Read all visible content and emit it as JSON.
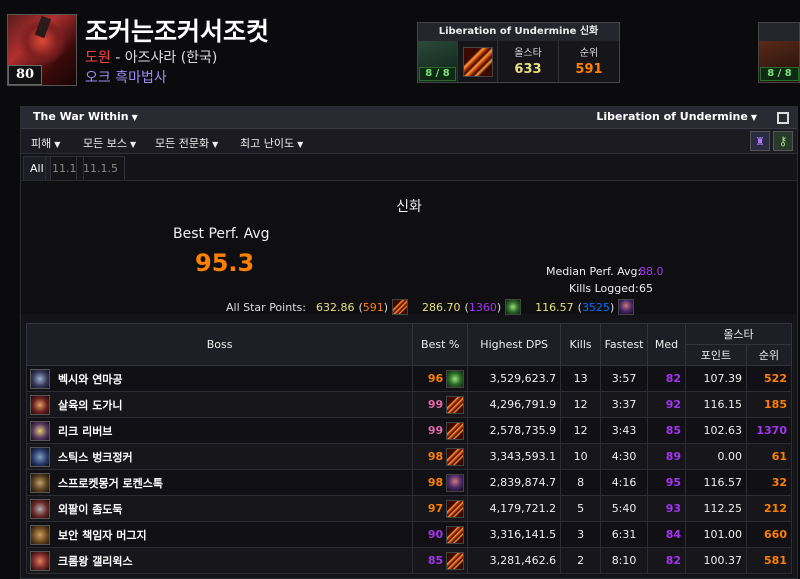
{
  "character": {
    "name": "조커는조커서조컷",
    "level": "80",
    "guild": "도원",
    "realm": " - 아즈샤라 (한국)",
    "class_spec": "오크 흑마법사"
  },
  "raid_summary": {
    "title": "Liberation of Undermine 신화",
    "kills": "8 / 8",
    "allstar_label": "올스타",
    "allstar_value": "633",
    "rank_label": "순위",
    "rank_value": "591",
    "second_kills": "8 / 8"
  },
  "tier_bar": {
    "expansion": "The War Within",
    "zone": "Liberation of Undermine"
  },
  "filters": [
    "피해",
    "모든 보스",
    "모든 전문화",
    "최고 난이도"
  ],
  "version_tabs": [
    "All",
    "11.1",
    "11.1.5"
  ],
  "summary": {
    "difficulty": "신화",
    "best_perf_label": "Best Perf. Avg",
    "best_perf_value": "95.3",
    "median_label": "Median Perf. Avg:",
    "median_value": "88.0",
    "kills_logged_label": "Kills Logged:",
    "kills_logged_value": "65",
    "all_star_label": "All Star Points:",
    "star1_points": "632.86",
    "star1_rank": "591",
    "star2_points": "286.70",
    "star2_rank": "1360",
    "star3_points": "116.57",
    "star3_rank": "3525"
  },
  "table": {
    "headers": {
      "boss": "Boss",
      "best": "Best %",
      "dps": "Highest DPS",
      "kills": "Kills",
      "fastest": "Fastest",
      "med": "Med",
      "allstar": "올스타",
      "points": "포인트",
      "rank": "순위"
    },
    "rows": [
      {
        "boss": "벡시와 연마공",
        "best": "96",
        "dps": "3,529,623.7",
        "kills": "13",
        "fastest": "3:57",
        "med": "82",
        "points": "107.39",
        "rank": "522"
      },
      {
        "boss": "살육의 도가니",
        "best": "99",
        "dps": "4,296,791.9",
        "kills": "12",
        "fastest": "3:37",
        "med": "92",
        "points": "116.15",
        "rank": "185"
      },
      {
        "boss": "리크 리버브",
        "best": "99",
        "dps": "2,578,735.9",
        "kills": "12",
        "fastest": "3:43",
        "med": "85",
        "points": "102.63",
        "rank": "1370"
      },
      {
        "boss": "스틱스 벙크정커",
        "best": "98",
        "dps": "3,343,593.1",
        "kills": "10",
        "fastest": "4:30",
        "med": "89",
        "points": "0.00",
        "rank": "61"
      },
      {
        "boss": "스프로켓몽거 로켄스톡",
        "best": "98",
        "dps": "2,839,874.7",
        "kills": "8",
        "fastest": "4:16",
        "med": "95",
        "points": "116.57",
        "rank": "32"
      },
      {
        "boss": "외팔이 좀도둑",
        "best": "97",
        "dps": "4,179,721.2",
        "kills": "5",
        "fastest": "5:40",
        "med": "93",
        "points": "112.25",
        "rank": "212"
      },
      {
        "boss": "보안 책임자 머그지",
        "best": "90",
        "dps": "3,316,141.5",
        "kills": "3",
        "fastest": "6:31",
        "med": "84",
        "points": "101.00",
        "rank": "660"
      },
      {
        "boss": "크롬왕 갤리윅스",
        "best": "85",
        "dps": "3,281,462.6",
        "kills": "2",
        "fastest": "8:10",
        "med": "82",
        "points": "100.37",
        "rank": "581"
      }
    ]
  },
  "colors": {
    "legendary": "#ff8000",
    "epic": "#a335ee",
    "rare": "#0070ff",
    "astounding": "#e268a8"
  }
}
